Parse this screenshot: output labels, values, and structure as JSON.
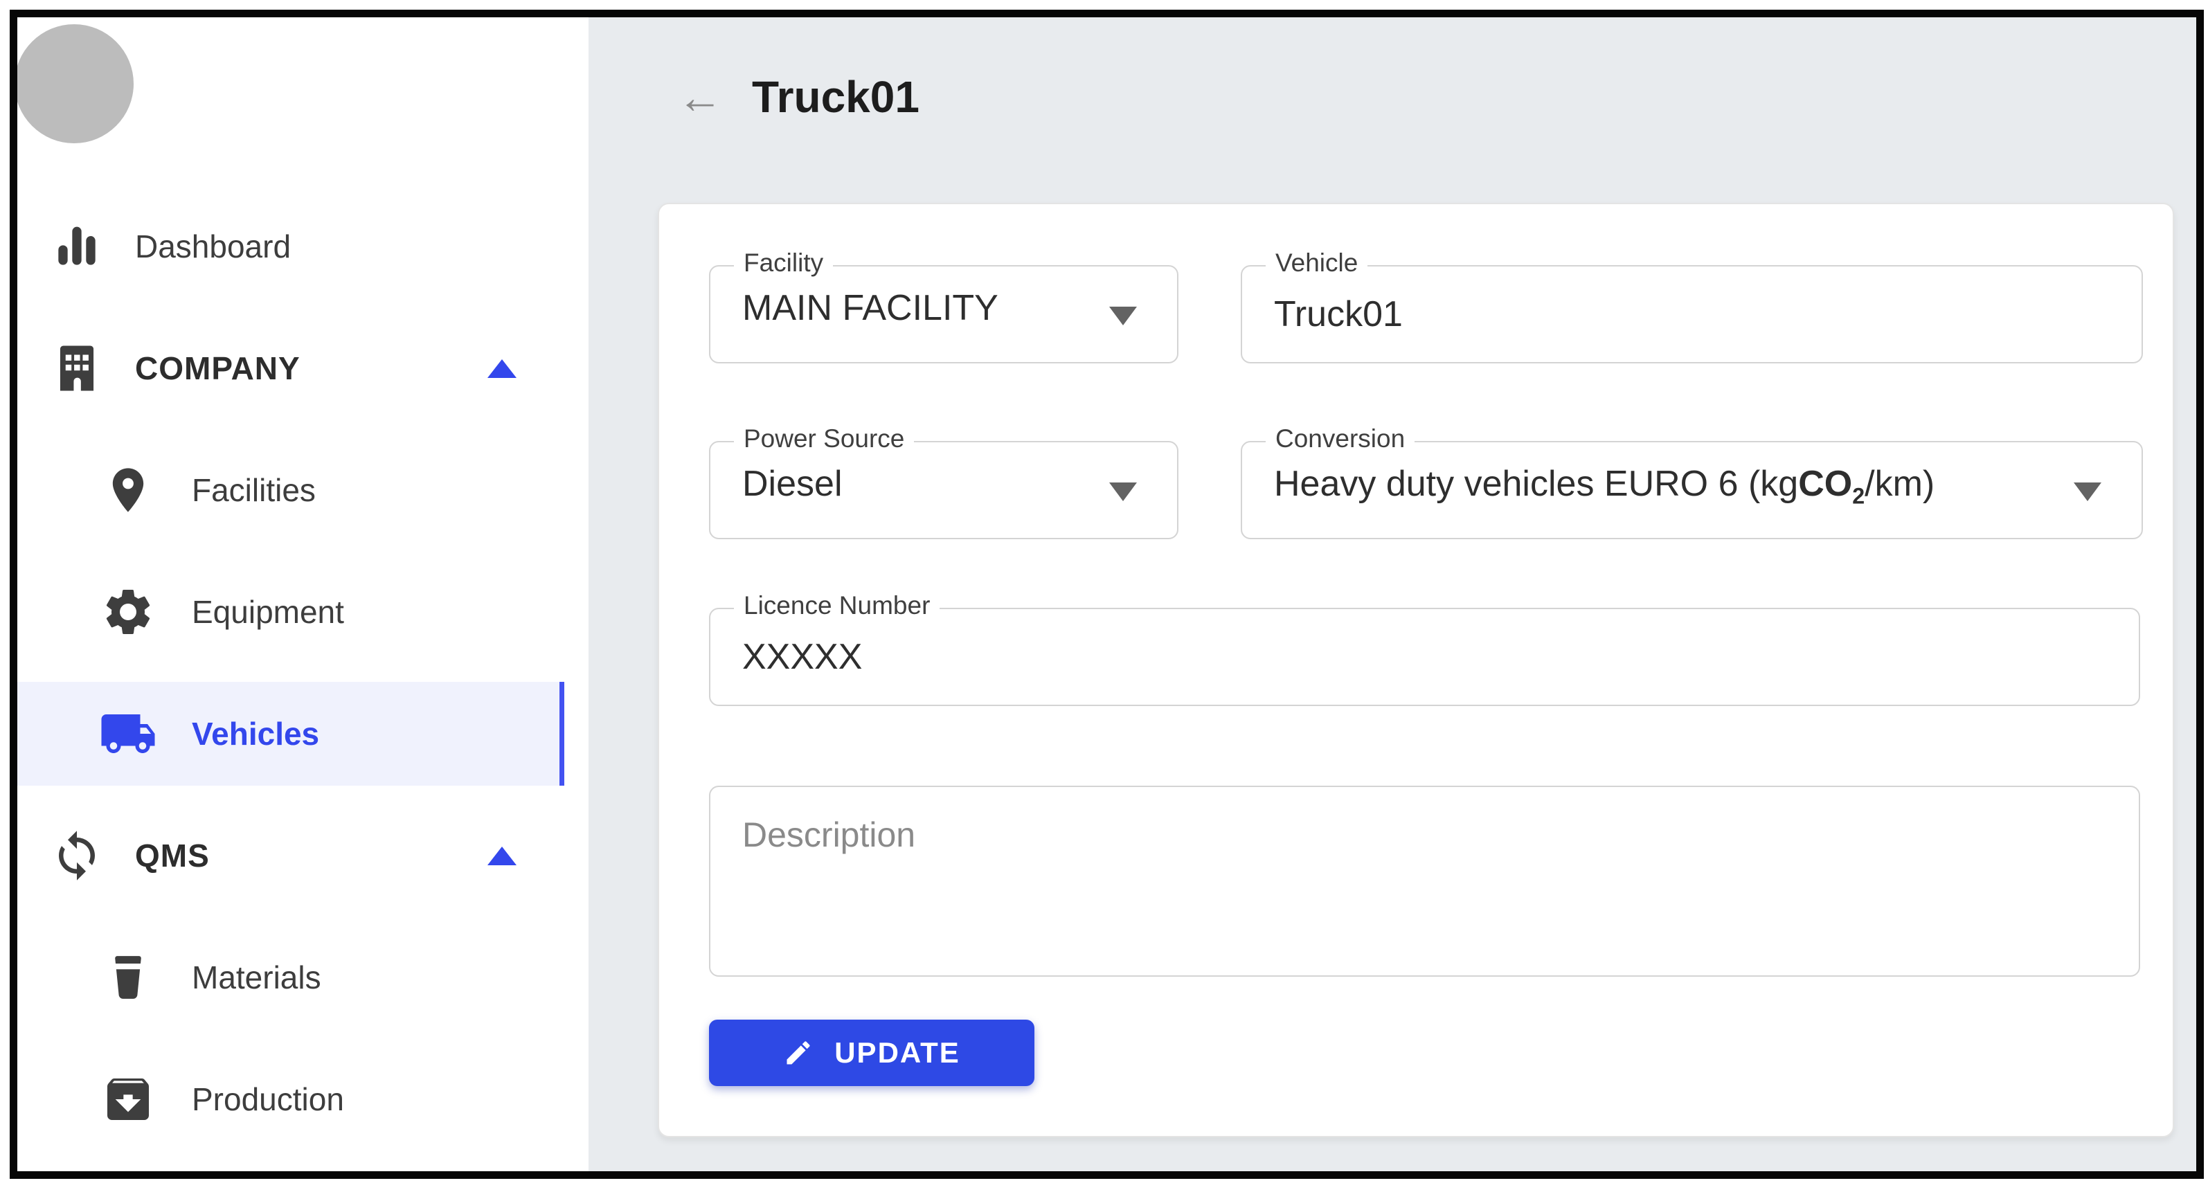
{
  "window": {
    "frame_color": "#060606"
  },
  "colors": {
    "accent_blue": "#3347ec",
    "active_bar": "#4352f1",
    "active_bg": "#f0f2fd",
    "button_blue": "#2e49e5",
    "main_bg": "#e8ebee",
    "field_border": "#d4d4d4",
    "avatar_gray": "#bcbcbc"
  },
  "sidebar": {
    "items": [
      {
        "label": "Dashboard",
        "icon": "bar-chart-icon",
        "level": 0,
        "bold": false,
        "active": false,
        "collapse_icon": null
      },
      {
        "label": "COMPANY",
        "icon": "building-icon",
        "level": 0,
        "bold": true,
        "active": false,
        "collapse_icon": "triangle-up-icon"
      },
      {
        "label": "Facilities",
        "icon": "location-pin-icon",
        "level": 1,
        "bold": false,
        "active": false,
        "collapse_icon": null
      },
      {
        "label": "Equipment",
        "icon": "gear-icon",
        "level": 1,
        "bold": false,
        "active": false,
        "collapse_icon": null
      },
      {
        "label": "Vehicles",
        "icon": "truck-icon",
        "level": 1,
        "bold": false,
        "active": true,
        "collapse_icon": null
      },
      {
        "label": "QMS",
        "icon": "recycle-icon",
        "level": 0,
        "bold": true,
        "active": false,
        "collapse_icon": "triangle-up-icon"
      },
      {
        "label": "Materials",
        "icon": "cup-icon",
        "level": 1,
        "bold": false,
        "active": false,
        "collapse_icon": null
      },
      {
        "label": "Production",
        "icon": "archive-icon",
        "level": 1,
        "bold": false,
        "active": false,
        "collapse_icon": null
      }
    ]
  },
  "header": {
    "back_icon": "arrow-left-icon",
    "back_glyph": "←",
    "title": "Truck01"
  },
  "form": {
    "facility": {
      "label": "Facility",
      "value": "MAIN FACILITY",
      "type": "select"
    },
    "vehicle": {
      "label": "Vehicle",
      "value": "Truck01",
      "type": "text"
    },
    "power_source": {
      "label": "Power Source",
      "value": "Diesel",
      "type": "select"
    },
    "conversion": {
      "label": "Conversion",
      "value_full": "Heavy duty vehicles EURO 6 (kgCO2/km)",
      "value_part1": "Heavy duty vehicles EURO 6 (kg",
      "co2_text": "CO",
      "co2_sub": "2",
      "value_part2": "/km)",
      "type": "select"
    },
    "licence_number": {
      "label": "Licence Number",
      "value": "XXXXX",
      "type": "text"
    },
    "description": {
      "placeholder": "Description",
      "value": ""
    },
    "update_button": {
      "label": "UPDATE",
      "icon": "pencil-icon"
    }
  }
}
